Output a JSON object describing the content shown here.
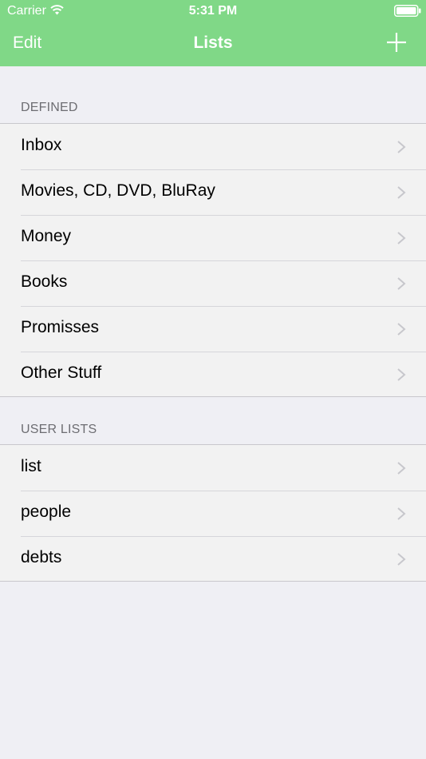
{
  "status_bar": {
    "carrier": "Carrier",
    "time": "5:31 PM",
    "wifi_icon": "wifi-icon",
    "battery_icon": "battery-icon"
  },
  "nav": {
    "edit_label": "Edit",
    "title": "Lists",
    "add_icon": "plus-icon"
  },
  "colors": {
    "header_bg": "#80d887",
    "page_bg": "#efeff4",
    "row_bg": "#f2f2f2",
    "section_header_text": "#6d6d72",
    "chevron": "#c7c7cc"
  },
  "sections": [
    {
      "header": "DEFINED",
      "items": [
        {
          "label": "Inbox"
        },
        {
          "label": "Movies, CD, DVD, BluRay"
        },
        {
          "label": "Money"
        },
        {
          "label": "Books"
        },
        {
          "label": "Promisses"
        },
        {
          "label": "Other Stuff"
        }
      ]
    },
    {
      "header": "USER LISTS",
      "items": [
        {
          "label": "list"
        },
        {
          "label": "people"
        },
        {
          "label": "debts"
        }
      ]
    }
  ]
}
